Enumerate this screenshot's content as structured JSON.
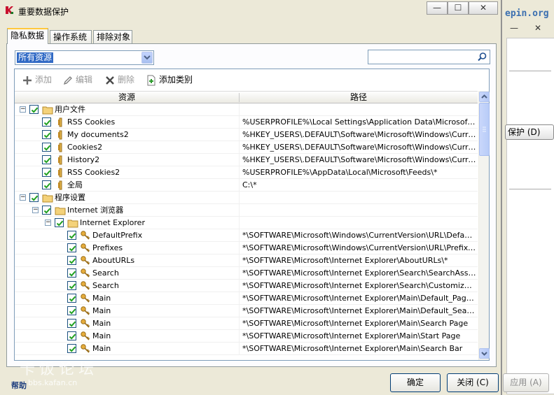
{
  "window": {
    "title": "重要数据保护",
    "btn_minimize": "—",
    "btn_maximize": "☐",
    "btn_close": "✕"
  },
  "background_window": {
    "site_text": "epin.org",
    "btn_minimize": "—",
    "btn_close": "✕",
    "protect_button": "保护 (D)"
  },
  "tabs": [
    {
      "label": "隐私数据",
      "active": true
    },
    {
      "label": "操作系统",
      "active": false
    },
    {
      "label": "排除对象",
      "active": false
    }
  ],
  "filter": {
    "selected": "所有资源"
  },
  "search": {
    "value": "",
    "placeholder": ""
  },
  "toolbar": {
    "add": "添加",
    "edit": "编辑",
    "delete": "删除",
    "add_category": "添加类别"
  },
  "columns": {
    "resource": "资源",
    "path": "路径"
  },
  "rows": [
    {
      "level": 0,
      "expander": "−",
      "icon": "folder-icon",
      "name": "用户文件",
      "path": ""
    },
    {
      "level": 1,
      "expander": "",
      "icon": "resource-icon",
      "name": "RSS Cookies",
      "path": "%USERPROFILE%\\Local Settings\\Application Data\\Microsoft\\F..."
    },
    {
      "level": 1,
      "expander": "",
      "icon": "resource-icon",
      "name": "My documents2",
      "path": "%HKEY_USERS\\.DEFAULT\\Software\\Microsoft\\Windows\\Curre..."
    },
    {
      "level": 1,
      "expander": "",
      "icon": "resource-icon",
      "name": "Cookies2",
      "path": "%HKEY_USERS\\.DEFAULT\\Software\\Microsoft\\Windows\\Curre..."
    },
    {
      "level": 1,
      "expander": "",
      "icon": "resource-icon",
      "name": "History2",
      "path": "%HKEY_USERS\\.DEFAULT\\Software\\Microsoft\\Windows\\Curre..."
    },
    {
      "level": 1,
      "expander": "",
      "icon": "resource-icon",
      "name": "RSS Cookies2",
      "path": "%USERPROFILE%\\AppData\\Local\\Microsoft\\Feeds\\*"
    },
    {
      "level": 1,
      "expander": "",
      "icon": "resource-icon",
      "name": "全局",
      "path": "C:\\*"
    },
    {
      "level": 0,
      "expander": "−",
      "icon": "folder-icon",
      "name": "程序设置",
      "path": ""
    },
    {
      "level": 1,
      "expander": "−",
      "icon": "folder-icon",
      "name": "Internet 浏览器",
      "path": ""
    },
    {
      "level": 2,
      "expander": "−",
      "icon": "folder-icon",
      "name": "Internet Explorer",
      "path": ""
    },
    {
      "level": 3,
      "expander": "",
      "icon": "key-icon",
      "name": "DefaultPrefix",
      "path": "*\\SOFTWARE\\Microsoft\\Windows\\CurrentVersion\\URL\\Default..."
    },
    {
      "level": 3,
      "expander": "",
      "icon": "key-icon",
      "name": "Prefixes",
      "path": "*\\SOFTWARE\\Microsoft\\Windows\\CurrentVersion\\URL\\Prefixes\\*"
    },
    {
      "level": 3,
      "expander": "",
      "icon": "key-icon",
      "name": "AboutURLs",
      "path": "*\\SOFTWARE\\Microsoft\\Internet Explorer\\AboutURLs\\*"
    },
    {
      "level": 3,
      "expander": "",
      "icon": "key-icon",
      "name": "Search",
      "path": "*\\SOFTWARE\\Microsoft\\Internet Explorer\\Search\\SearchAssis..."
    },
    {
      "level": 3,
      "expander": "",
      "icon": "key-icon",
      "name": "Search",
      "path": "*\\SOFTWARE\\Microsoft\\Internet Explorer\\Search\\CustomizeS..."
    },
    {
      "level": 3,
      "expander": "",
      "icon": "key-icon",
      "name": "Main",
      "path": "*\\SOFTWARE\\Microsoft\\Internet Explorer\\Main\\Default_Page_..."
    },
    {
      "level": 3,
      "expander": "",
      "icon": "key-icon",
      "name": "Main",
      "path": "*\\SOFTWARE\\Microsoft\\Internet Explorer\\Main\\Default_Searc..."
    },
    {
      "level": 3,
      "expander": "",
      "icon": "key-icon",
      "name": "Main",
      "path": "*\\SOFTWARE\\Microsoft\\Internet Explorer\\Main\\Search Page"
    },
    {
      "level": 3,
      "expander": "",
      "icon": "key-icon",
      "name": "Main",
      "path": "*\\SOFTWARE\\Microsoft\\Internet Explorer\\Main\\Start Page"
    },
    {
      "level": 3,
      "expander": "",
      "icon": "key-icon",
      "name": "Main",
      "path": "*\\SOFTWARE\\Microsoft\\Internet Explorer\\Main\\Search Bar"
    }
  ],
  "footer": {
    "help": "帮助",
    "watermark": "卡饭论坛",
    "watermark_url": "bbs.kafan.cn",
    "ok": "确定",
    "close": "关闭 (C)",
    "apply": "应用 (A)"
  },
  "colors": {
    "dialog_bg": "#ece9d8",
    "selection": "#316ac5",
    "checkbox_check": "#21a121",
    "folder": "#f4d27a",
    "key": "#d9a13a"
  }
}
